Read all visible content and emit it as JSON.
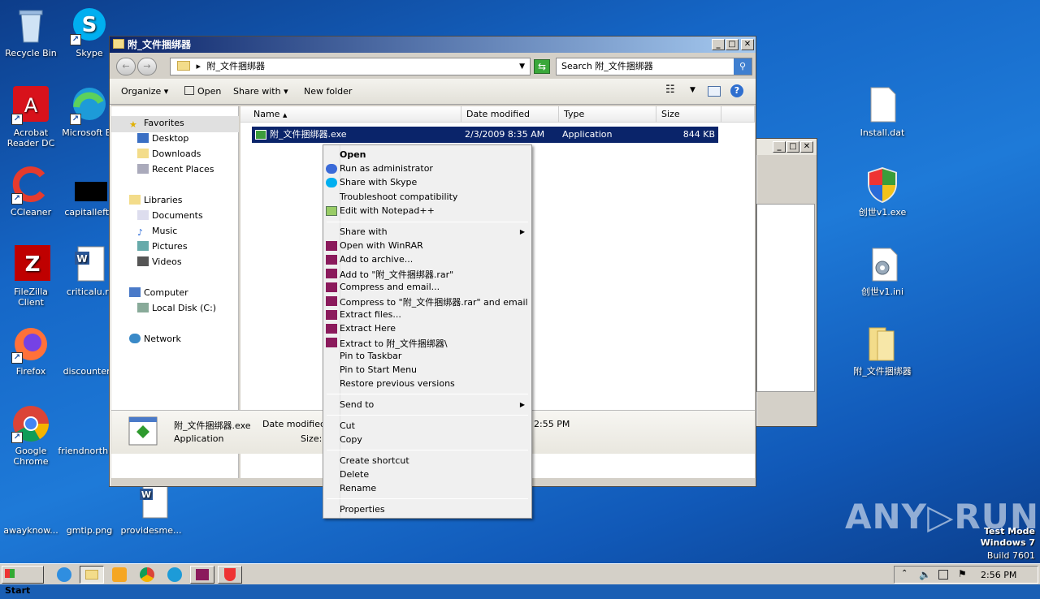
{
  "desktop": {
    "icons": [
      {
        "label": "Recycle Bin",
        "name": "recycle-bin-icon"
      },
      {
        "label": "Skype",
        "name": "skype-icon"
      },
      {
        "label": "Acrobat Reader DC",
        "name": "acrobat-icon"
      },
      {
        "label": "Microsoft Ed",
        "name": "edge-icon"
      },
      {
        "label": "CCleaner",
        "name": "ccleaner-icon"
      },
      {
        "label": "capitalleft.j",
        "name": "image-file-icon"
      },
      {
        "label": "FileZilla Client",
        "name": "filezilla-icon"
      },
      {
        "label": "criticalu.rt",
        "name": "word-doc-icon"
      },
      {
        "label": "Firefox",
        "name": "firefox-icon"
      },
      {
        "label": "discountent",
        "name": "blank-file-icon"
      },
      {
        "label": "Google Chrome",
        "name": "chrome-icon"
      },
      {
        "label": "friendnorth.",
        "name": "blank-file-icon"
      },
      {
        "label": "awayknow...",
        "name": "blank-file-icon"
      },
      {
        "label": "gmtip.png",
        "name": "image-file-icon"
      },
      {
        "label": "providesme...",
        "name": "word-doc-icon"
      },
      {
        "label": "Install.dat",
        "name": "dat-file-icon"
      },
      {
        "label": "创世v1.exe",
        "name": "shield-exe-icon"
      },
      {
        "label": "创世v1.ini",
        "name": "ini-file-icon"
      },
      {
        "label": "附_文件捆绑器",
        "name": "folder-icon"
      }
    ],
    "watermark": "ANY▷RUN",
    "testmode": [
      "Test Mode",
      "Windows 7",
      "Build 7601"
    ]
  },
  "explorer": {
    "title": "附_文件捆绑器",
    "breadcrumb": "附_文件捆绑器",
    "search_placeholder": "Search 附_文件捆绑器",
    "toolbar": {
      "organize": "Organize",
      "open": "Open",
      "share_with": "Share with",
      "new_folder": "New folder"
    },
    "nav": {
      "favorites": "Favorites",
      "desktop": "Desktop",
      "downloads": "Downloads",
      "recent": "Recent Places",
      "libraries": "Libraries",
      "documents": "Documents",
      "music": "Music",
      "pictures": "Pictures",
      "videos": "Videos",
      "computer": "Computer",
      "local_disk": "Local Disk (C:)",
      "network": "Network"
    },
    "columns": {
      "name": "Name",
      "date": "Date modified",
      "type": "Type",
      "size": "Size"
    },
    "file": {
      "name": "附_文件捆绑器.exe",
      "date": "2/3/2009 8:35 AM",
      "type": "Application",
      "size": "844 KB"
    },
    "details": {
      "name": "附_文件捆绑器.exe",
      "date_label": "Date modified:",
      "date_tail": "2:55 PM",
      "type": "Application",
      "size_label": "Size:"
    }
  },
  "context_menu": {
    "open": "Open",
    "run_admin": "Run as administrator",
    "share_skype": "Share with Skype",
    "troubleshoot": "Troubleshoot compatibility",
    "notepad": "Edit with Notepad++",
    "share_with": "Share with",
    "winrar_open": "Open with WinRAR",
    "add_archive": "Add to archive...",
    "add_rar": "Add to \"附_文件捆绑器.rar\"",
    "compress_email": "Compress and email...",
    "compress_rar_email": "Compress to \"附_文件捆绑器.rar\" and email",
    "extract_files": "Extract files...",
    "extract_here": "Extract Here",
    "extract_to": "Extract to 附_文件捆绑器\\",
    "pin_taskbar": "Pin to Taskbar",
    "pin_start": "Pin to Start Menu",
    "restore": "Restore previous versions",
    "send_to": "Send to",
    "cut": "Cut",
    "copy": "Copy",
    "create_shortcut": "Create shortcut",
    "delete": "Delete",
    "rename": "Rename",
    "properties": "Properties"
  },
  "taskbar": {
    "start": "Start",
    "clock": "2:56 PM"
  }
}
